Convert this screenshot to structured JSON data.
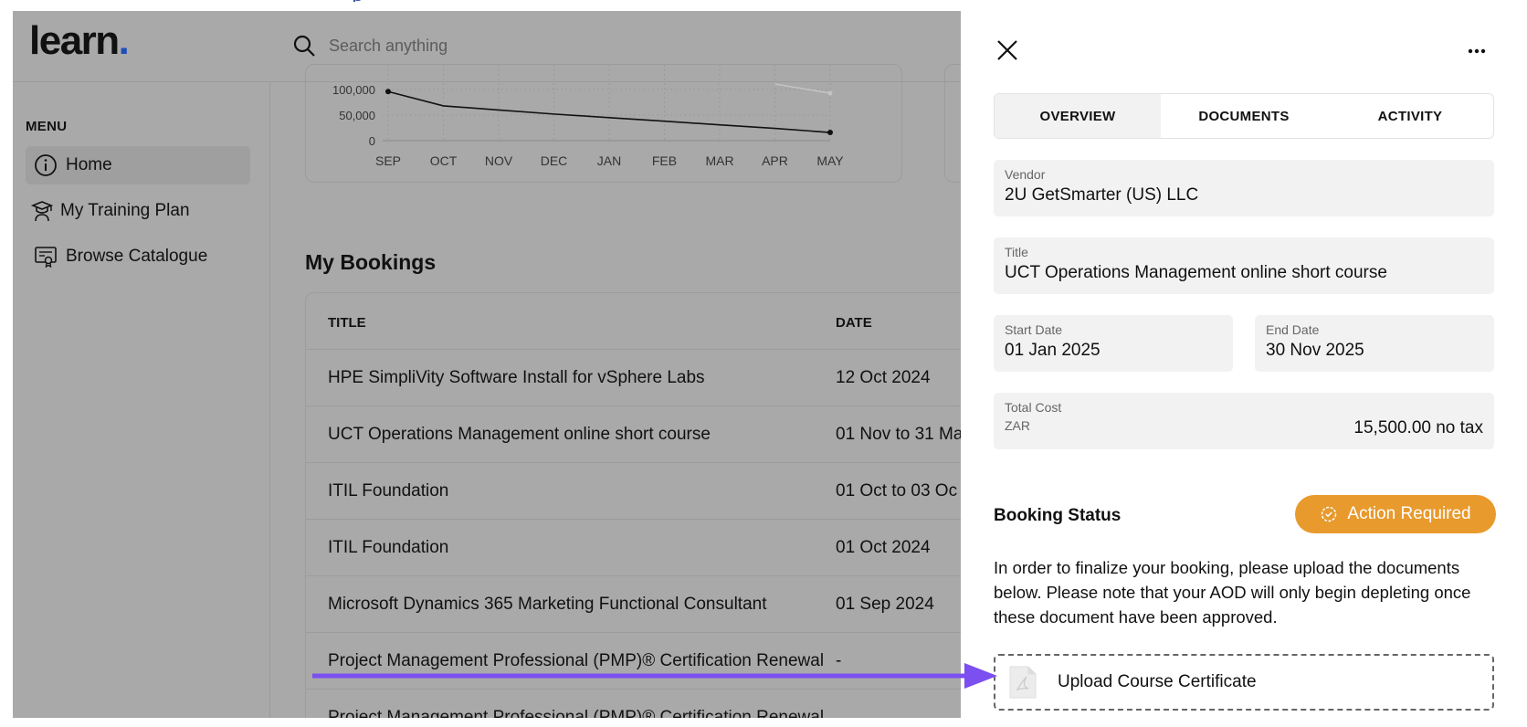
{
  "app": {
    "logo_text": "learn",
    "logo_dot": ".",
    "brand_color": "#1f4fb5"
  },
  "search": {
    "placeholder": "Search anything",
    "icon": "search-icon"
  },
  "sidebar": {
    "heading": "MENU",
    "items": [
      {
        "label": "Home",
        "icon": "info-icon",
        "active": true
      },
      {
        "label": "My Training Plan",
        "icon": "graduate-icon",
        "active": false
      },
      {
        "label": "Browse Catalogue",
        "icon": "certificate-icon",
        "active": false
      }
    ]
  },
  "chart_data": {
    "type": "line",
    "categories": [
      "SEP",
      "OCT",
      "NOV",
      "DEC",
      "JAN",
      "FEB",
      "MAR",
      "APR",
      "MAY"
    ],
    "y_ticks": [
      "100,000",
      "50,000",
      "0"
    ],
    "ylim": [
      0,
      100000
    ],
    "series": [
      {
        "values": [
          96000,
          68000,
          60000,
          52000,
          45000,
          38000,
          31000,
          24000,
          16000
        ],
        "color": "#111111"
      }
    ],
    "faint_series_color": "#c4c4c4",
    "grid": true
  },
  "bookings": {
    "title": "My Bookings",
    "columns": [
      "TITLE",
      "DATE"
    ],
    "rows": [
      {
        "title": "HPE SimpliVity Software Install for vSphere Labs",
        "date": "12 Oct 2024"
      },
      {
        "title": "UCT Operations Management online short course",
        "date": "01 Nov to 31 Ma"
      },
      {
        "title": "ITIL Foundation",
        "date": "01 Oct to 03 Oc"
      },
      {
        "title": "ITIL Foundation",
        "date": "01 Oct 2024"
      },
      {
        "title": "Microsoft Dynamics 365 Marketing Functional Consultant",
        "date": "01 Sep 2024"
      },
      {
        "title": "Project Management Professional (PMP)® Certification Renewal",
        "date": "-"
      },
      {
        "title": "Project Management Professional (PMP)® Certification Renewal",
        "date": ""
      }
    ]
  },
  "panel": {
    "tabs": [
      {
        "label": "OVERVIEW",
        "active": true
      },
      {
        "label": "DOCUMENTS",
        "active": false
      },
      {
        "label": "ACTIVITY",
        "active": false
      }
    ],
    "vendor": {
      "label": "Vendor",
      "value": "2U GetSmarter (US) LLC"
    },
    "title": {
      "label": "Title",
      "value": "UCT Operations Management online short course"
    },
    "start_date": {
      "label": "Start Date",
      "value": "01 Jan 2025"
    },
    "end_date": {
      "label": "End Date",
      "value": "30 Nov 2025"
    },
    "total_cost": {
      "label": "Total Cost",
      "currency": "ZAR",
      "amount": "15,500.00 no tax"
    },
    "booking_status_label": "Booking Status",
    "status_badge": {
      "label": "Action Required",
      "color": "#e89a2d"
    },
    "note": "In order to finalize your booking, please upload the documents below. Please note that your AOD will only begin depleting once these document have been approved.",
    "upload": {
      "label": "Upload Course Certificate",
      "icon": "pdf-file-icon"
    }
  },
  "annotation": {
    "arrow_color": "#7b4ff0"
  }
}
